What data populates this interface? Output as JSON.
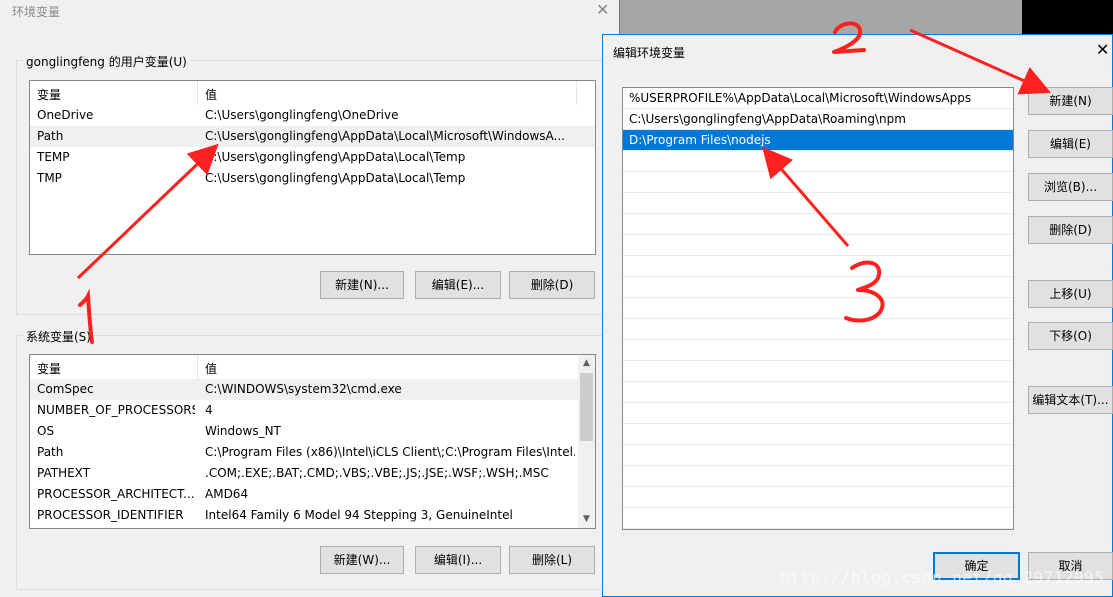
{
  "env_window": {
    "title": "环境变量",
    "close_glyph": "✕",
    "user_group_label": "gonglingfeng 的用户变量(U)",
    "user_columns": [
      "变量",
      "值"
    ],
    "user_rows": [
      {
        "name": "OneDrive",
        "value": "C:\\Users\\gonglingfeng\\OneDrive"
      },
      {
        "name": "Path",
        "value": "C:\\Users\\gonglingfeng\\AppData\\Local\\Microsoft\\WindowsA..."
      },
      {
        "name": "TEMP",
        "value": "C:\\Users\\gonglingfeng\\AppData\\Local\\Temp"
      },
      {
        "name": "TMP",
        "value": "C:\\Users\\gonglingfeng\\AppData\\Local\\Temp"
      }
    ],
    "user_buttons": {
      "new": "新建(N)...",
      "edit": "编辑(E)...",
      "delete": "删除(D)"
    },
    "system_group_label": "系统变量(S)",
    "system_columns": [
      "变量",
      "值"
    ],
    "system_rows": [
      {
        "name": "ComSpec",
        "value": "C:\\WINDOWS\\system32\\cmd.exe"
      },
      {
        "name": "NUMBER_OF_PROCESSORS",
        "value": "4"
      },
      {
        "name": "OS",
        "value": "Windows_NT"
      },
      {
        "name": "Path",
        "value": "C:\\Program Files (x86)\\Intel\\iCLS Client\\;C:\\Program Files\\Intel..."
      },
      {
        "name": "PATHEXT",
        "value": ".COM;.EXE;.BAT;.CMD;.VBS;.VBE;.JS;.JSE;.WSF;.WSH;.MSC"
      },
      {
        "name": "PROCESSOR_ARCHITECT...",
        "value": "AMD64"
      },
      {
        "name": "PROCESSOR_IDENTIFIER",
        "value": "Intel64 Family 6 Model 94 Stepping 3, GenuineIntel"
      }
    ],
    "system_buttons": {
      "new": "新建(W)...",
      "edit": "编辑(I)...",
      "delete": "删除(L)"
    }
  },
  "edit_dialog": {
    "title": "编辑环境变量",
    "close_glyph": "✕",
    "paths": [
      "%USERPROFILE%\\AppData\\Local\\Microsoft\\WindowsApps",
      "C:\\Users\\gonglingfeng\\AppData\\Roaming\\npm",
      "D:\\Program Files\\nodejs"
    ],
    "selected_index": 2,
    "buttons": {
      "new": "新建(N)",
      "edit": "编辑(E)",
      "browse": "浏览(B)...",
      "delete": "删除(D)",
      "move_up": "上移(U)",
      "move_down": "下移(O)",
      "edit_text": "编辑文本(T)...",
      "ok": "确定",
      "cancel": "取消"
    }
  },
  "scroll_glyphs": {
    "up": "▲",
    "down": "▼"
  },
  "annotations": {
    "one": "1",
    "two": "2",
    "three": "3",
    "color": "#ff2020"
  },
  "watermark": "http://blog.csdn.net/qq_29712995"
}
